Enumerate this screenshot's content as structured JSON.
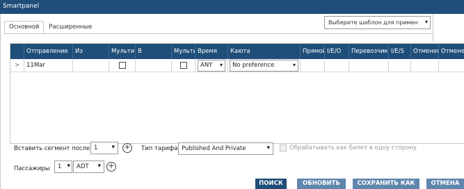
{
  "window": {
    "title": "Smartpanel"
  },
  "tabs": [
    {
      "label": "Основной",
      "active": true
    },
    {
      "label": "Расширенные",
      "active": false
    }
  ],
  "template_select": {
    "value": "Выберите шаблон для примен",
    "icon": "chevron-down-icon"
  },
  "grid": {
    "headers": [
      "Отправление",
      "Из",
      "Мульти",
      "В",
      "Мульти",
      "Время",
      "Каюта",
      "Прямой",
      "I/E/O",
      "Перевозчик",
      "I/E/S",
      "Отменен",
      "Отмене"
    ],
    "row": {
      "marker": ">",
      "date": "11Mar",
      "multi_from_checked": false,
      "multi_to_checked": false,
      "time": "ANY",
      "cabin": "No preference"
    }
  },
  "form": {
    "insert_segment_label": "Вставить сегмент после:",
    "insert_segment_value": "1",
    "fare_type_label": "Тип тарифа:",
    "fare_type_value": "Published And Private",
    "oneway_label": "Обрабатывать как билет в одну сторону",
    "oneway_checked": false,
    "passengers_label": "Пассажиры",
    "passengers_count": "1",
    "passenger_type": "ADT"
  },
  "buttons": {
    "search": "ПОИСК",
    "refresh": "ОБНОВИТЬ",
    "save_as": "СОХРАНИТЬ КАК",
    "cancel": "ОТМЕНА"
  },
  "colors": {
    "header": "#1f4e79",
    "button": "#1f4e79",
    "button_light": "#5f86ad"
  }
}
